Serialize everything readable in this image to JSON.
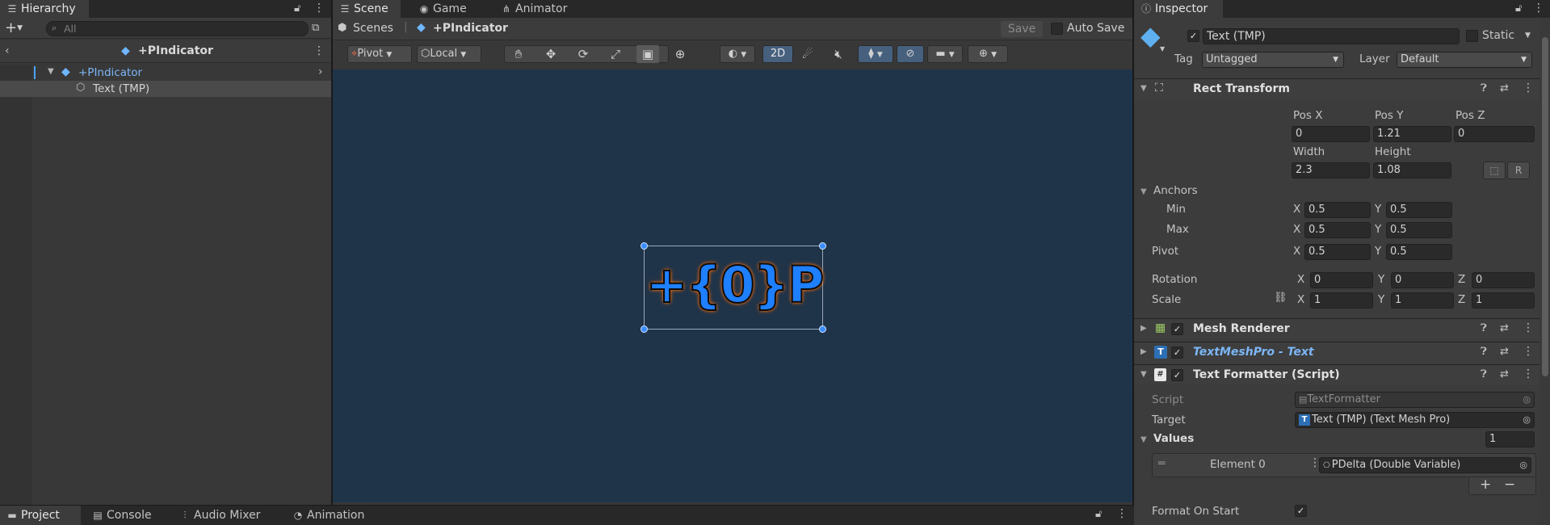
{
  "hierarchy": {
    "tab_label": "Hierarchy",
    "search_placeholder": "All",
    "prefab_title": "+PIndicator",
    "items": [
      {
        "label": "+PIndicator"
      },
      {
        "label": "Text (TMP)"
      }
    ]
  },
  "scene": {
    "tabs": [
      {
        "label": "Scene"
      },
      {
        "label": "Game"
      },
      {
        "label": "Animator"
      }
    ],
    "breadcrumb_root": "Scenes",
    "breadcrumb_prefab": "+PIndicator",
    "save_label": "Save",
    "autosave_label": "Auto Save",
    "pivot_label": "Pivot",
    "local_label": "Local",
    "mode_2d": "2D",
    "canvas_text": "+{0}P",
    "bg_color": "#203449"
  },
  "inspector": {
    "tab_label": "Inspector",
    "object_name": "Text (TMP)",
    "static_label": "Static",
    "tag_label": "Tag",
    "tag_value": "Untagged",
    "layer_label": "Layer",
    "layer_value": "Default",
    "rect_transform": {
      "title": "Rect Transform",
      "pos_x_label": "Pos X",
      "pos_y_label": "Pos Y",
      "pos_z_label": "Pos Z",
      "pos_x": "0",
      "pos_y": "1.21",
      "pos_z": "0",
      "width_label": "Width",
      "height_label": "Height",
      "width": "2.3",
      "height": "1.08",
      "anchors_label": "Anchors",
      "min_label": "Min",
      "max_label": "Max",
      "pivot_label": "Pivot",
      "min_x": "0.5",
      "min_y": "0.5",
      "max_x": "0.5",
      "max_y": "0.5",
      "pivot_x": "0.5",
      "pivot_y": "0.5",
      "rotation_label": "Rotation",
      "rot_x": "0",
      "rot_y": "0",
      "rot_z": "0",
      "scale_label": "Scale",
      "scale_x": "1",
      "scale_y": "1",
      "scale_z": "1",
      "x": "X",
      "y": "Y",
      "z": "Z"
    },
    "components": {
      "mesh_renderer": "Mesh Renderer",
      "tmp_text": "TextMeshPro - Text",
      "text_formatter": "Text Formatter (Script)"
    },
    "formatter": {
      "script_label": "Script",
      "script_value": "TextFormatter",
      "target_label": "Target",
      "target_value": "Text (TMP) (Text Mesh Pro)",
      "values_label": "Values",
      "values_count": "1",
      "element_label": "Element 0",
      "element_value": "PDelta (Double Variable)",
      "format_on_start_label": "Format On Start"
    }
  },
  "bottom": {
    "tabs": [
      {
        "label": "Project"
      },
      {
        "label": "Console"
      },
      {
        "label": "Audio Mixer"
      },
      {
        "label": "Animation"
      }
    ]
  }
}
